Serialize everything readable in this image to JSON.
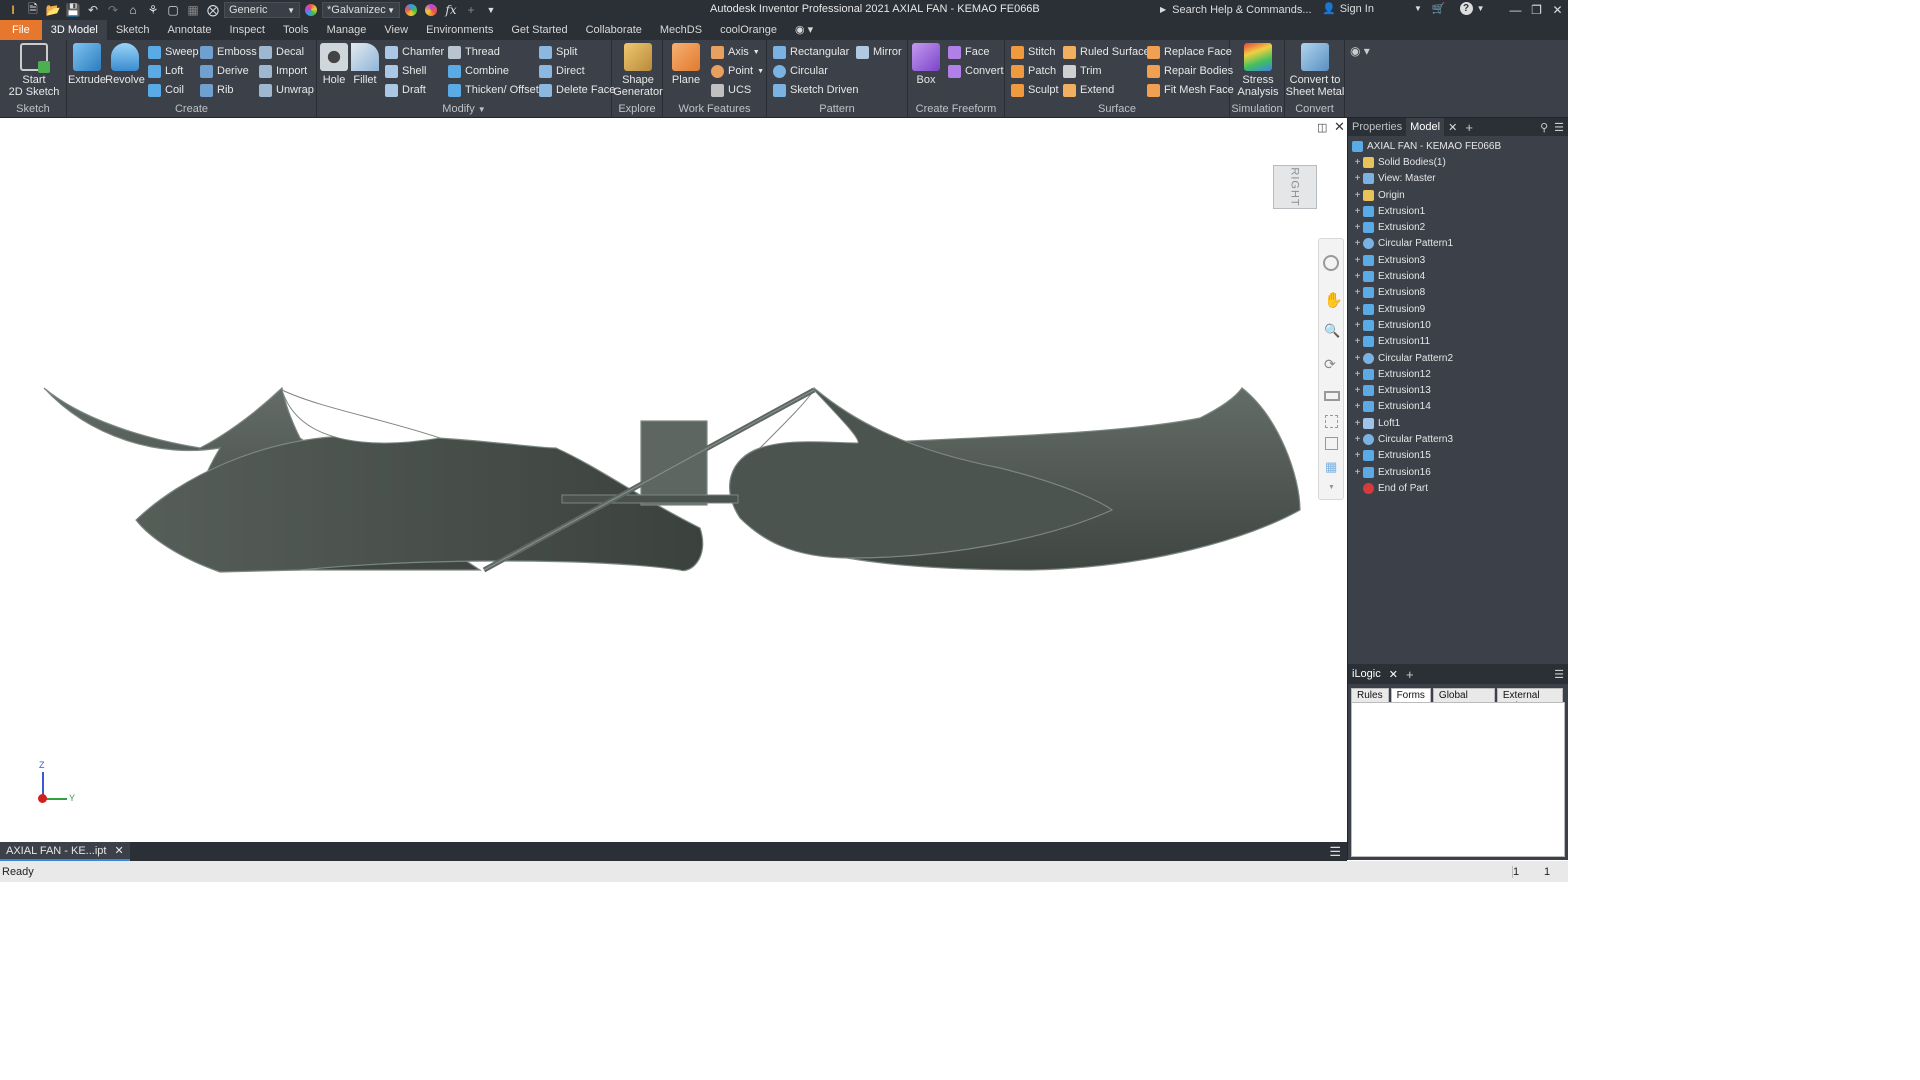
{
  "title_bar": {
    "app_title": "Autodesk Inventor Professional 2021    AXIAL FAN - KEMAO FE066B",
    "material_select": "Generic",
    "appearance_select": "*Galvanizec",
    "search_placeholder": "Search Help & Commands...",
    "sign_in": "Sign In",
    "fx": "fx"
  },
  "tabs": [
    "File",
    "3D Model",
    "Sketch",
    "Annotate",
    "Inspect",
    "Tools",
    "Manage",
    "View",
    "Environments",
    "Get Started",
    "Collaborate",
    "MechDS",
    "coolOrange"
  ],
  "active_tab": "3D Model",
  "ribbon": {
    "sketch": {
      "label": "Sketch",
      "start": "Start\n2D Sketch"
    },
    "create": {
      "label": "Create",
      "extrude": "Extrude",
      "revolve": "Revolve",
      "sweep": "Sweep",
      "loft": "Loft",
      "coil": "Coil",
      "emboss": "Emboss",
      "derive": "Derive",
      "rib": "Rib",
      "decal": "Decal",
      "import": "Import",
      "unwrap": "Unwrap"
    },
    "modify": {
      "label": "Modify",
      "hole": "Hole",
      "fillet": "Fillet",
      "chamfer": "Chamfer",
      "shell": "Shell",
      "draft": "Draft",
      "thread": "Thread",
      "combine": "Combine",
      "thicken": "Thicken/ Offset",
      "split": "Split",
      "direct": "Direct",
      "delete_face": "Delete Face"
    },
    "explore": {
      "label": "Explore",
      "shape_generator": "Shape\nGenerator"
    },
    "work_features": {
      "label": "Work Features",
      "plane": "Plane",
      "axis": "Axis",
      "point": "Point",
      "ucs": "UCS"
    },
    "pattern": {
      "label": "Pattern",
      "rectangular": "Rectangular",
      "circular": "Circular",
      "sketch_driven": "Sketch Driven",
      "mirror": "Mirror"
    },
    "freeform": {
      "label": "Create Freeform",
      "box": "Box",
      "face": "Face",
      "convert": "Convert"
    },
    "surface": {
      "label": "Surface",
      "stitch": "Stitch",
      "patch": "Patch",
      "sculpt": "Sculpt",
      "ruled": "Ruled Surface",
      "trim": "Trim",
      "extend": "Extend",
      "replace_face": "Replace Face",
      "repair": "Repair Bodies",
      "fit_mesh": "Fit Mesh Face"
    },
    "simulation": {
      "label": "Simulation",
      "stress": "Stress\nAnalysis"
    },
    "convert": {
      "label": "Convert",
      "sheet_metal": "Convert to\nSheet Metal"
    }
  },
  "viewcube_label": "RIGHT",
  "axis_labels": {
    "z": "Z",
    "y": "Y"
  },
  "browser": {
    "tabs": [
      "Properties",
      "Model"
    ],
    "active": "Model",
    "root": "AXIAL FAN - KEMAO FE066B",
    "nodes": [
      {
        "label": "Solid Bodies(1)",
        "icon": "folder"
      },
      {
        "label": "View: Master",
        "icon": "view"
      },
      {
        "label": "Origin",
        "icon": "folder"
      },
      {
        "label": "Extrusion1",
        "icon": "feature"
      },
      {
        "label": "Extrusion2",
        "icon": "feature"
      },
      {
        "label": "Circular Pattern1",
        "icon": "pattern"
      },
      {
        "label": "Extrusion3",
        "icon": "feature"
      },
      {
        "label": "Extrusion4",
        "icon": "feature"
      },
      {
        "label": "Extrusion8",
        "icon": "feature"
      },
      {
        "label": "Extrusion9",
        "icon": "feature"
      },
      {
        "label": "Extrusion10",
        "icon": "feature"
      },
      {
        "label": "Extrusion11",
        "icon": "feature"
      },
      {
        "label": "Circular Pattern2",
        "icon": "pattern"
      },
      {
        "label": "Extrusion12",
        "icon": "feature"
      },
      {
        "label": "Extrusion13",
        "icon": "feature"
      },
      {
        "label": "Extrusion14",
        "icon": "feature"
      },
      {
        "label": "Loft1",
        "icon": "loft"
      },
      {
        "label": "Circular Pattern3",
        "icon": "pattern"
      },
      {
        "label": "Extrusion15",
        "icon": "feature"
      },
      {
        "label": "Extrusion16",
        "icon": "feature"
      },
      {
        "label": "End of Part",
        "icon": "end"
      }
    ]
  },
  "ilogic": {
    "title": "iLogic",
    "tabs": [
      "Rules",
      "Forms",
      "Global Forms",
      "External Rules"
    ],
    "active": "Forms"
  },
  "document_tab": "AXIAL FAN - KE...ipt",
  "status": {
    "text": "Ready",
    "count_1": "1",
    "count_2": "1"
  },
  "colors": {
    "file_tab": "#e8772e",
    "ribbon_bg": "#3b4049",
    "dark_bg": "#2b2f36",
    "fan_body": "#525a55",
    "fan_dark": "#3e4541"
  }
}
